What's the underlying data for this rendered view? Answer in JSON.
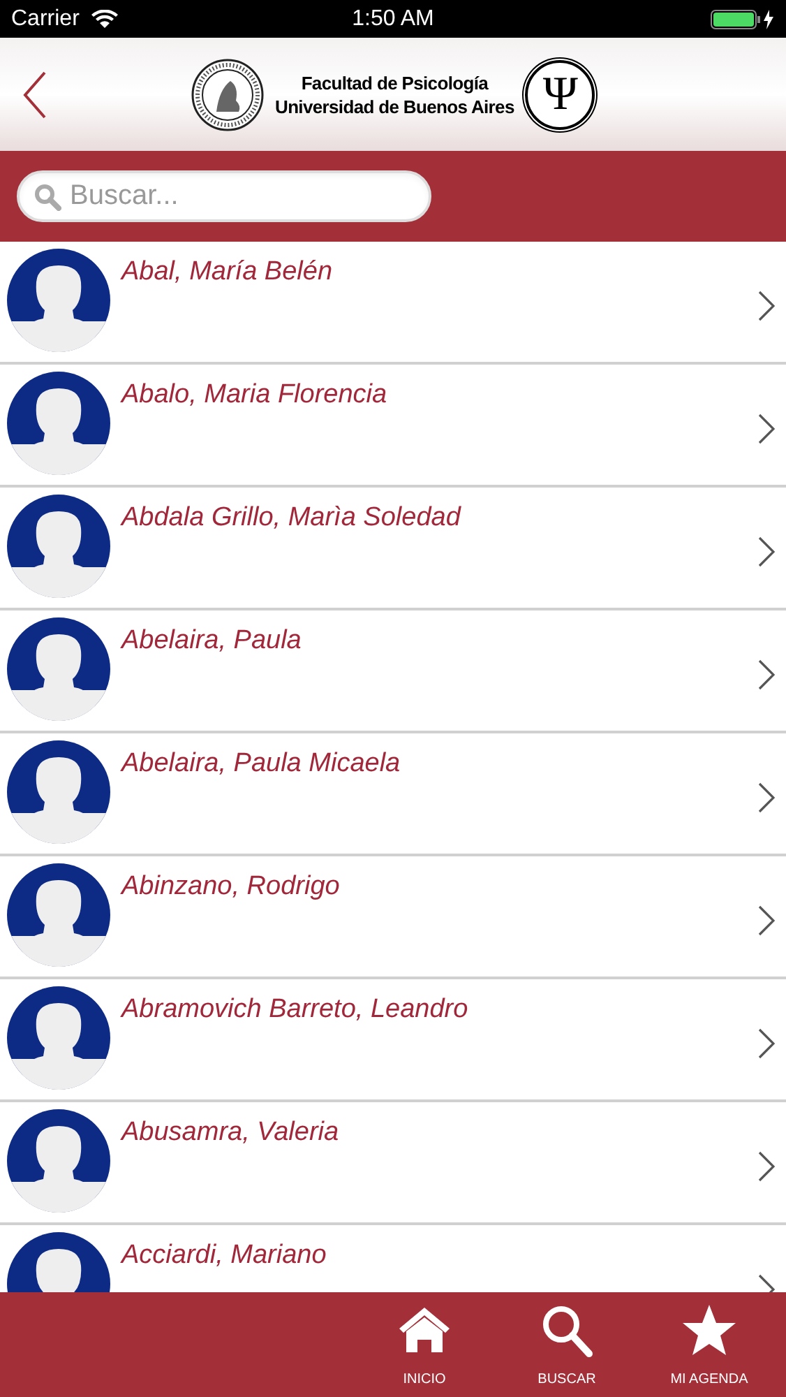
{
  "status_bar": {
    "carrier": "Carrier",
    "time": "1:50 AM"
  },
  "header": {
    "title_line_1": "Facultad de Psicología",
    "title_line_2": "Universidad de Buenos Aires",
    "emblem": "Ψ"
  },
  "search": {
    "placeholder": "Buscar..."
  },
  "people": [
    {
      "name": "Abal, María Belén"
    },
    {
      "name": "Abalo, Maria Florencia"
    },
    {
      "name": "Abdala Grillo, Marìa Soledad"
    },
    {
      "name": "Abelaira, Paula"
    },
    {
      "name": "Abelaira, Paula Micaela"
    },
    {
      "name": "Abinzano, Rodrigo"
    },
    {
      "name": "Abramovich Barreto, Leandro"
    },
    {
      "name": "Abusamra, Valeria"
    },
    {
      "name": "Acciardi, Mariano"
    }
  ],
  "tab_bar": [
    {
      "kind": "home",
      "label": "INICIO"
    },
    {
      "kind": "search",
      "label": "BUSCAR"
    },
    {
      "kind": "star",
      "label": "MI AGENDA"
    }
  ]
}
